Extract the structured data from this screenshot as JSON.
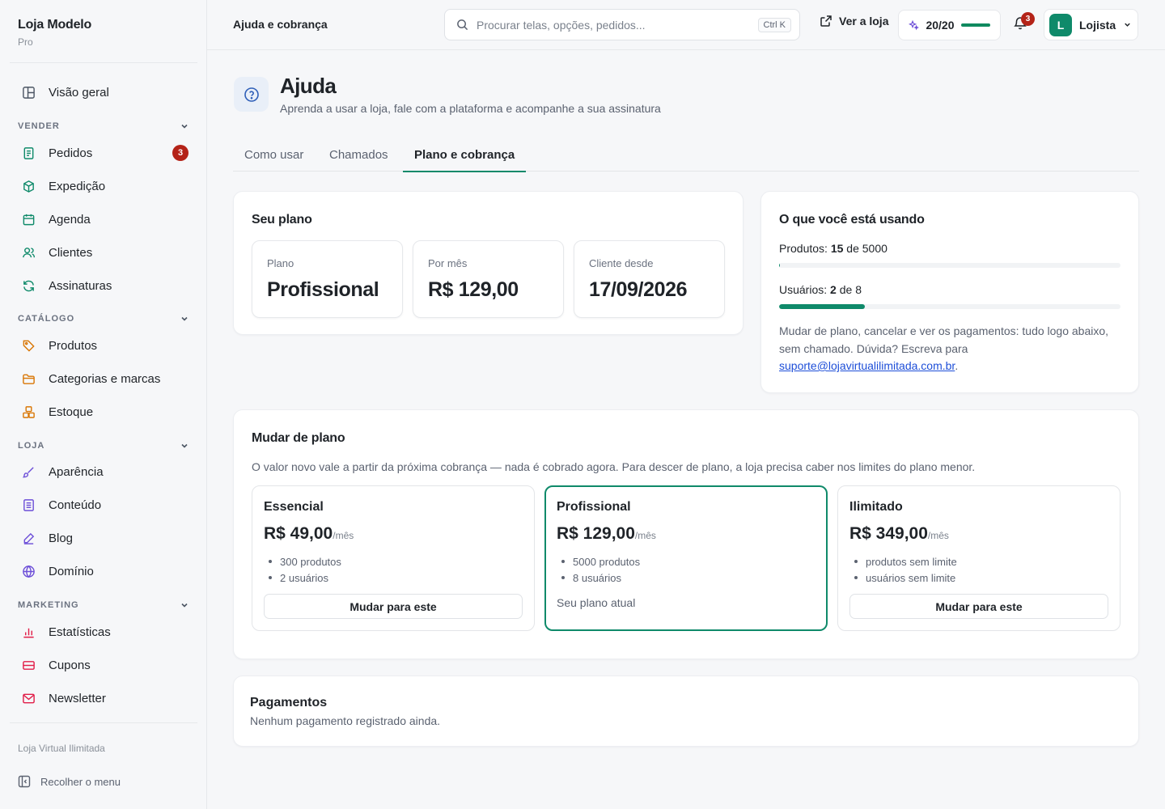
{
  "brand": {
    "name": "Loja Modelo",
    "plan": "Pro"
  },
  "sidebar": {
    "overview": "Visão geral",
    "groups": {
      "vender": "VENDER",
      "catalogo": "CATÁLOGO",
      "loja": "LOJA",
      "marketing": "MARKETING"
    },
    "items": {
      "pedidos": "Pedidos",
      "pedidos_badge": "3",
      "expedicao": "Expedição",
      "agenda": "Agenda",
      "clientes": "Clientes",
      "assinaturas": "Assinaturas",
      "produtos": "Produtos",
      "categorias": "Categorias e marcas",
      "estoque": "Estoque",
      "aparencia": "Aparência",
      "conteudo": "Conteúdo",
      "blog": "Blog",
      "dominio": "Domínio",
      "estatisticas": "Estatísticas",
      "cupons": "Cupons",
      "newsletter": "Newsletter"
    },
    "footer": "Loja Virtual Ilimitada",
    "collapse": "Recolher o menu"
  },
  "topbar": {
    "breadcrumb": "Ajuda e cobrança",
    "search_placeholder": "Procurar telas, opções, pedidos...",
    "search_shortcut": "Ctrl K",
    "view_store": "Ver a loja",
    "quota_label": "20/20",
    "quota_fraction": 1.0,
    "notifications_count": "3",
    "user_initial": "L",
    "user_name": "Lojista"
  },
  "header": {
    "title": "Ajuda",
    "subtitle": "Aprenda a usar a loja, fale com a plataforma e acompanhe a sua assinatura"
  },
  "tabs": [
    {
      "label": "Como usar"
    },
    {
      "label": "Chamados"
    },
    {
      "label": "Plano e cobrança"
    }
  ],
  "current_plan": {
    "title": "Seu plano",
    "stats": [
      {
        "label": "Plano",
        "value": "Profissional"
      },
      {
        "label": "Por mês",
        "value": "R$ 129,00"
      },
      {
        "label": "Cliente desde",
        "value": "17/09/2026"
      }
    ]
  },
  "usage": {
    "title": "O que você está usando",
    "products": {
      "prefix": "Produtos:",
      "used": "15",
      "sep": "de",
      "limit": "5000",
      "fraction": 0.003
    },
    "users": {
      "prefix": "Usuários:",
      "used": "2",
      "sep": "de",
      "limit": "8",
      "fraction": 0.25
    },
    "note": "Mudar de plano, cancelar e ver os pagamentos: tudo logo abaixo, sem chamado. Dúvida? Escreva para",
    "email": "suporte@lojavirtualilimitada.com.br",
    "note_end": "."
  },
  "change_plan": {
    "title": "Mudar de plano",
    "description": "O valor novo vale a partir da próxima cobrança — nada é cobrado agora. Para descer de plano, a loja precisa caber nos limites do plano menor.",
    "per_month": "/mês",
    "switch_label": "Mudar para este",
    "current_label": "Seu plano atual",
    "plans": [
      {
        "name": "Essencial",
        "price": "R$ 49,00",
        "features": [
          "300 produtos",
          "2 usuários"
        ]
      },
      {
        "name": "Profissional",
        "price": "R$ 129,00",
        "features": [
          "5000 produtos",
          "8 usuários"
        ]
      },
      {
        "name": "Ilimitado",
        "price": "R$ 349,00",
        "features": [
          "produtos sem limite",
          "usuários sem limite"
        ]
      }
    ]
  },
  "payments": {
    "title": "Pagamentos",
    "empty": "Nenhum pagamento registrado ainda."
  },
  "colors": {
    "accent": "#0f8a6a",
    "badge": "#b42318",
    "link": "#1d4ed8"
  }
}
